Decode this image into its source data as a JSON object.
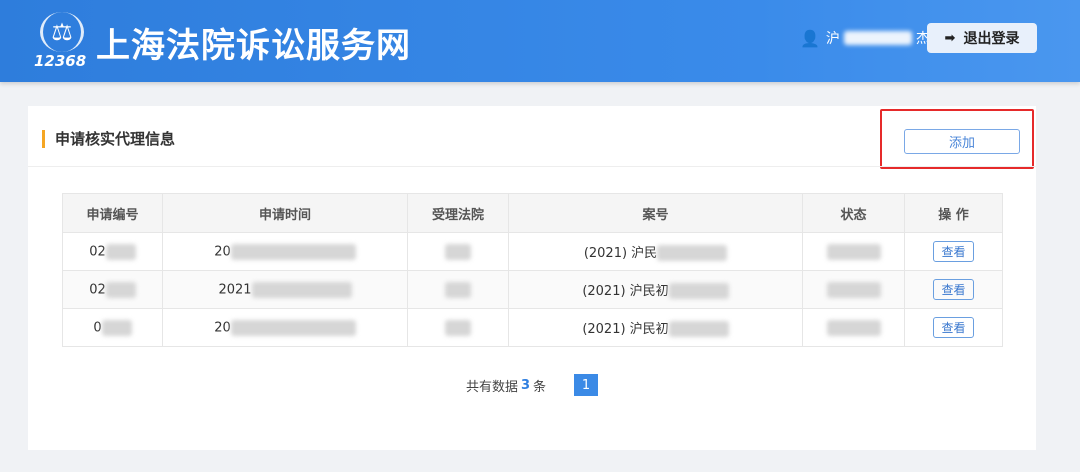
{
  "header": {
    "logo_text": "12368",
    "site_title": "上海法院诉讼服务网",
    "user_name_visible_prefix": "沪",
    "user_name_visible_suffix": "杰",
    "logout_label": "退出登录"
  },
  "card": {
    "title": "申请核实代理信息",
    "add_label": "添加"
  },
  "table": {
    "columns": [
      "申请编号",
      "申请时间",
      "受理法院",
      "案号",
      "状态",
      "操 作"
    ],
    "rows": [
      {
        "id": "02",
        "time": "20",
        "court": "",
        "case": "(2021) 沪民",
        "status": "",
        "action": "查看"
      },
      {
        "id": "02",
        "time": "2021",
        "court": "",
        "case": "(2021) 沪民初",
        "status": "",
        "action": "查看"
      },
      {
        "id": "0",
        "time": "20",
        "court": "",
        "case": "(2021) 沪民初",
        "status": "",
        "action": "查看"
      }
    ]
  },
  "pagination": {
    "prefix": "共有数据",
    "count": "3",
    "suffix": "条",
    "current_page": "1"
  }
}
